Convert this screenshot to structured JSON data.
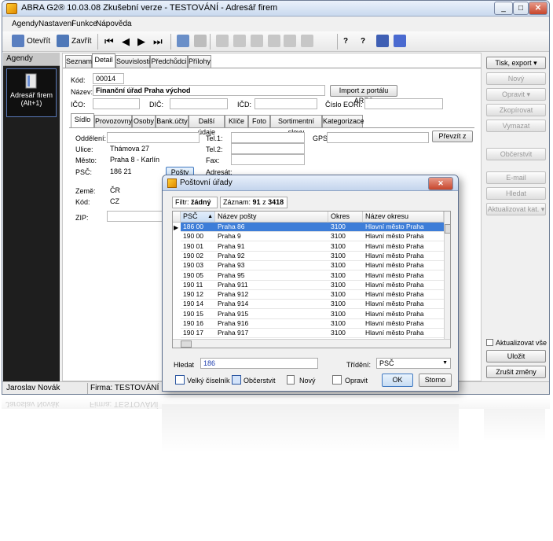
{
  "window": {
    "title": "ABRA G2® 10.03.08 Zkušební verze - TESTOVÁNÍ - Adresář firem",
    "min": "_",
    "max": "□",
    "close": "✕"
  },
  "menu": [
    "Agendy",
    "Nastavení",
    "Funkce",
    "Nápověda"
  ],
  "toolbar": {
    "open_label": "Otevřít",
    "close_label": "Zavřít"
  },
  "agenda": {
    "header": "Agendy",
    "item_label": "Adresář firem",
    "item_shortcut": "(Alt+1)"
  },
  "tabs_top": [
    "Seznam",
    "Detail",
    "Souvislosti",
    "Předchůdci",
    "Přílohy"
  ],
  "detail": {
    "kod_label": "Kód:",
    "kod_value": "00014",
    "nazev_label": "Název:",
    "nazev_value": "Finanční úřad Praha východ",
    "ares_button": "Import z portálu ARES",
    "ico_label": "IČO:",
    "dic_label": "DIČ:",
    "icd_label": "IČD:",
    "eori_label": "Číslo EORI:"
  },
  "tabs_inner": [
    "Sídlo",
    "Provozovny",
    "Osoby",
    "Bank.účty",
    "Další údaje",
    "Klíče",
    "Foto",
    "Sortimentní slevy",
    "Kategorizace"
  ],
  "sidlo": {
    "oddeleni_label": "Oddělení:",
    "ulice_label": "Ulice:",
    "ulice_value": "Thámova 27",
    "mesto_label": "Město:",
    "mesto_value": "Praha 8 - Karlín",
    "psc_label": "PSČ:",
    "psc_value": "186 21",
    "posty_button": "Pošty",
    "tel1_label": "Tel.1:",
    "tel2_label": "Tel.2:",
    "fax_label": "Fax:",
    "adresat_label": "Adresát:",
    "gps_label": "GPS:",
    "prevzit_button": "Převzít z",
    "zeme_label": "Země:",
    "zeme_value": "ČR",
    "kod_label": "Kód:",
    "kod_value": "CZ",
    "zip_label": "ZIP:"
  },
  "right_buttons": {
    "tisk": "Tisk, export",
    "novy": "Nový",
    "opravit": "Opravit",
    "zkopirovat": "Zkopírovat",
    "vymazat": "Vymazat",
    "obcerstvit": "Občerstvit",
    "email": "E-mail",
    "hledat": "Hledat",
    "aktualizovat_kat": "Aktualizovat kat.",
    "aktualizovat_vse": "Aktualizovat vše",
    "ulozit": "Uložit",
    "zrusit": "Zrušit změny"
  },
  "status": {
    "user": "Jaroslav Novák",
    "firm": "Firma: TESTOVÁNÍ"
  },
  "dialog": {
    "title": "Poštovní úřady",
    "filter_label": "Filtr:",
    "filter_value": "žádný",
    "records_label": "Záznam:",
    "records_current": "91",
    "records_of": "z",
    "records_total": "3418",
    "columns": [
      "PSČ",
      "Název pošty",
      "Okres",
      "Název okresu"
    ],
    "rows": [
      [
        "186 00",
        "Praha 86",
        "3100",
        "Hlavní město Praha"
      ],
      [
        "190 00",
        "Praha 9",
        "3100",
        "Hlavní město Praha"
      ],
      [
        "190 01",
        "Praha 91",
        "3100",
        "Hlavní město Praha"
      ],
      [
        "190 02",
        "Praha 92",
        "3100",
        "Hlavní město Praha"
      ],
      [
        "190 03",
        "Praha 93",
        "3100",
        "Hlavní město Praha"
      ],
      [
        "190 05",
        "Praha 95",
        "3100",
        "Hlavní město Praha"
      ],
      [
        "190 11",
        "Praha 911",
        "3100",
        "Hlavní město Praha"
      ],
      [
        "190 12",
        "Praha 912",
        "3100",
        "Hlavní město Praha"
      ],
      [
        "190 14",
        "Praha 914",
        "3100",
        "Hlavní město Praha"
      ],
      [
        "190 15",
        "Praha 915",
        "3100",
        "Hlavní město Praha"
      ],
      [
        "190 16",
        "Praha 916",
        "3100",
        "Hlavní město Praha"
      ],
      [
        "190 17",
        "Praha 917",
        "3100",
        "Hlavní město Praha"
      ]
    ],
    "search_label": "Hledat",
    "search_value": "186",
    "sort_label": "Třídění:",
    "sort_value": "PSČ",
    "btn_ciselnik": "Velký číselník",
    "btn_obcerstvit": "Občerstvit",
    "btn_novy": "Nový",
    "btn_opravit": "Opravit",
    "btn_ok": "OK",
    "btn_storno": "Storno"
  }
}
